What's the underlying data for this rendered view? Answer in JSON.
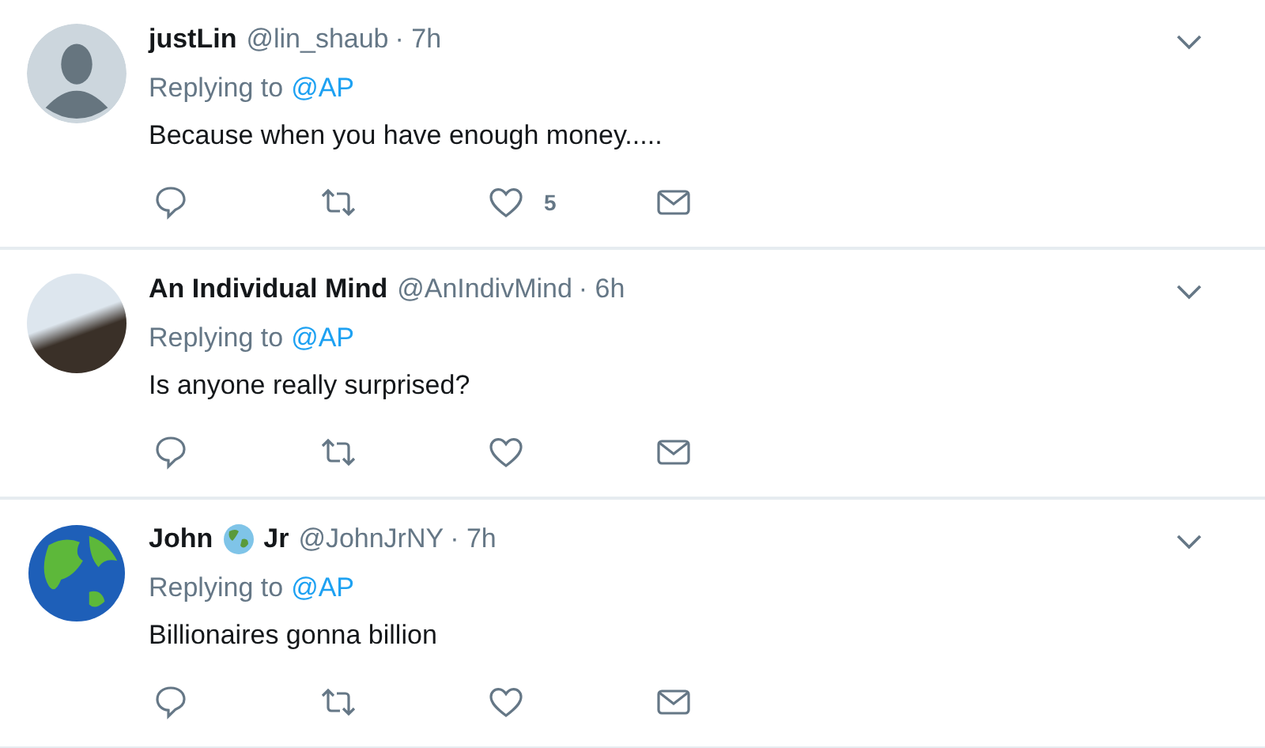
{
  "tweets": [
    {
      "avatar": {
        "kind": "default"
      },
      "name_parts": [
        {
          "kind": "text",
          "text": "justLin"
        }
      ],
      "handle": "@lin_shaub",
      "time": "· 7h",
      "replying_label": "Replying to",
      "replying_to": "@AP",
      "text": "Because when you have enough money.....",
      "likes": "5"
    },
    {
      "avatar": {
        "kind": "photo"
      },
      "name_parts": [
        {
          "kind": "text",
          "text": "An Individual Mind"
        }
      ],
      "handle": "@AnIndivMind",
      "time": "· 6h",
      "replying_label": "Replying to",
      "replying_to": "@AP",
      "text": "Is anyone really surprised?"
    },
    {
      "avatar": {
        "kind": "globe"
      },
      "name_parts": [
        {
          "kind": "text",
          "text": "John"
        },
        {
          "kind": "emoji"
        },
        {
          "kind": "text",
          "text": "Jr"
        }
      ],
      "handle": "@JohnJrNY",
      "time": "· 7h",
      "replying_label": "Replying to",
      "replying_to": "@AP",
      "text": "Billionaires gonna billion"
    }
  ]
}
